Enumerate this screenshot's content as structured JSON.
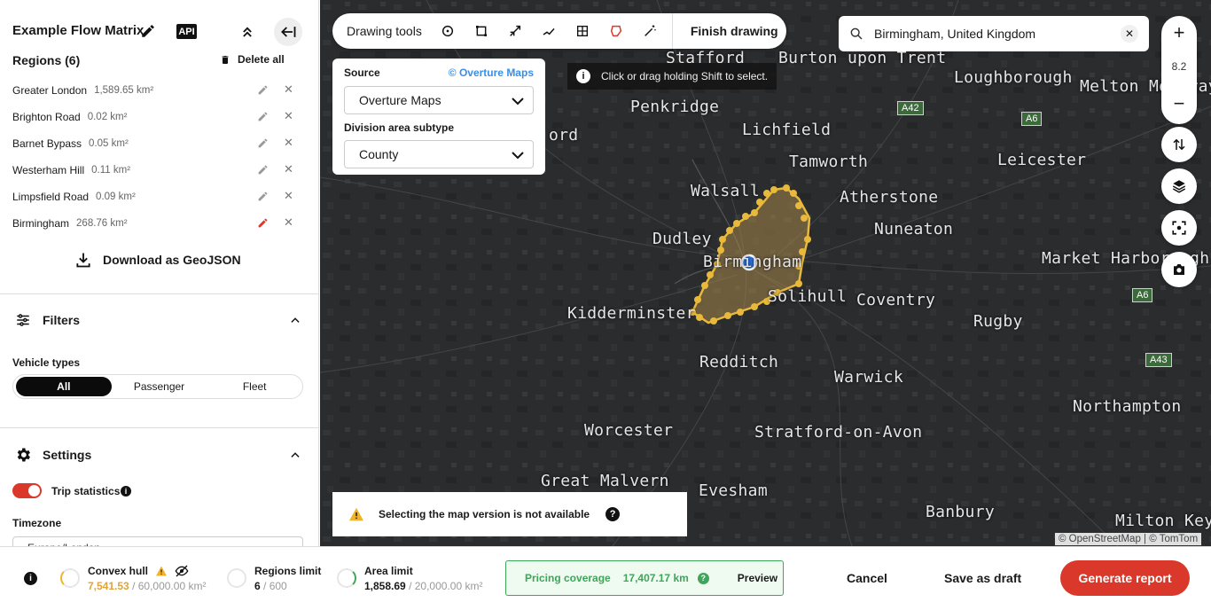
{
  "header": {
    "title": "Example Flow Matrix",
    "api_label": "API"
  },
  "regions": {
    "title": "Regions (6)",
    "delete_all": "Delete all",
    "items": [
      {
        "name": "Greater London",
        "area": "1,589.65 km²"
      },
      {
        "name": "Brighton Road",
        "area": "0.02 km²"
      },
      {
        "name": "Barnet Bypass",
        "area": "0.05 km²"
      },
      {
        "name": "Westerham Hill",
        "area": "0.11 km²"
      },
      {
        "name": "Limpsfield Road",
        "area": "0.09 km²"
      },
      {
        "name": "Birmingham",
        "area": "268.76 km²"
      }
    ],
    "download": "Download as GeoJSON"
  },
  "filters": {
    "title": "Filters",
    "vehicle_types_label": "Vehicle types",
    "options": [
      "All",
      "Passenger",
      "Fleet"
    ],
    "selected": "All"
  },
  "settings": {
    "title": "Settings",
    "trip_statistics": "Trip statistics",
    "trip_statistics_on": true,
    "timezone_label": "Timezone",
    "timezone_value": "Europe/London"
  },
  "toolbar": {
    "label": "Drawing tools",
    "finish": "Finish drawing"
  },
  "source_panel": {
    "source_label": "Source",
    "source_link": "© Overture Maps",
    "source_value": "Overture Maps",
    "subtype_label": "Division area subtype",
    "subtype_value": "County"
  },
  "hint": "Click or drag holding Shift to select.",
  "search": {
    "value": "Birmingham, United Kingdom"
  },
  "zoom": {
    "level": "8.2"
  },
  "map": {
    "cities": [
      "Stafford",
      "Burton upon Trent",
      "Loughborough",
      "Melton Mowbray",
      "Penkridge",
      "Lichfield",
      "Tamworth",
      "Leicester",
      "Walsall",
      "Atherstone",
      "Dudley",
      "Nuneaton",
      "Market Harborough",
      "Birmingham",
      "Solihull",
      "Coventry",
      "Rugby",
      "Kidderminster",
      "Redditch",
      "Warwick",
      "Northampton",
      "Worcester",
      "Stratford-on-Avon",
      "Great Malvern",
      "Evesham",
      "Banbury",
      "Milton Keyn",
      "ord"
    ],
    "roads": [
      "A42",
      "A6",
      "A6",
      "A43"
    ],
    "attribution": "© OpenStreetMap | © TomTom"
  },
  "warning": "Selecting the map version is not available",
  "footer": {
    "convex_hull": {
      "title": "Convex hull",
      "value": "7,541.53",
      "limit": "/ 60,000.00 km²",
      "fraction": 0.126
    },
    "regions_limit": {
      "title": "Regions limit",
      "value": "6",
      "limit": "/ 600",
      "fraction": 0.01
    },
    "area_limit": {
      "title": "Area limit",
      "value": "1,858.69",
      "limit": "/ 20,000.00 km²",
      "fraction": 0.093
    },
    "pricing": {
      "label": "Pricing coverage",
      "value": "17,407.17 km",
      "preview": "Preview"
    },
    "cancel": "Cancel",
    "save_draft": "Save as draft",
    "generate": "Generate report"
  },
  "colors": {
    "accent": "#d9382a",
    "region_fill": "#a6874a",
    "region_stroke": "#e8b93a",
    "pricing_green": "#3fa55a"
  }
}
